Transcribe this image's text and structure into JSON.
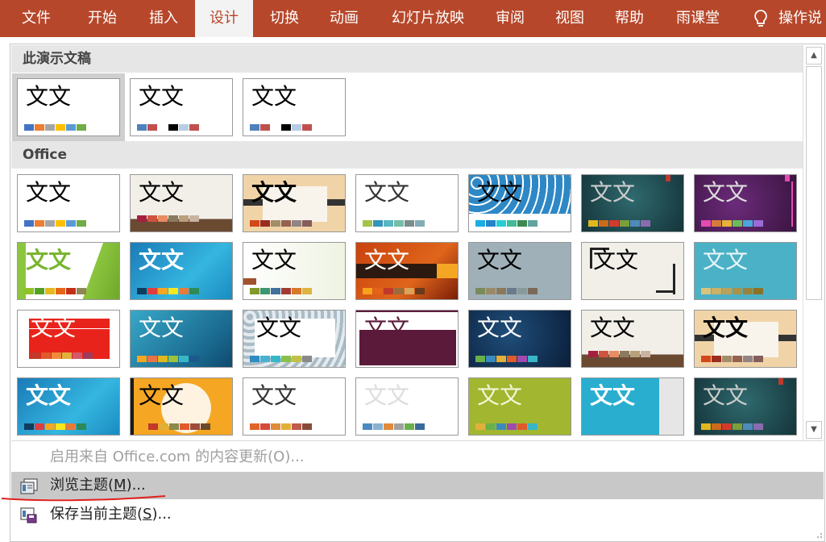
{
  "ribbon": {
    "tabs": [
      {
        "label": "文件"
      },
      {
        "label": "开始"
      },
      {
        "label": "插入"
      },
      {
        "label": "设计"
      },
      {
        "label": "切换"
      },
      {
        "label": "动画"
      },
      {
        "label": "幻灯片放映"
      },
      {
        "label": "审阅"
      },
      {
        "label": "视图"
      },
      {
        "label": "帮助"
      },
      {
        "label": "雨课堂"
      }
    ],
    "active_tab": "设计",
    "tell_me": "操作说",
    "colors": {
      "accent": "#b7472a"
    }
  },
  "gallery": {
    "section_this": "此演示文稿",
    "section_office": "Office",
    "theme_sample_text": "文文"
  },
  "menu": {
    "enable_updates": "启用来自 Office.com 的内容更新(O)...",
    "browse_prefix": "浏览主题(",
    "browse_key": "M",
    "browse_suffix": ")...",
    "save_prefix": "保存当前主题(",
    "save_key": "S",
    "save_suffix": ")..."
  }
}
